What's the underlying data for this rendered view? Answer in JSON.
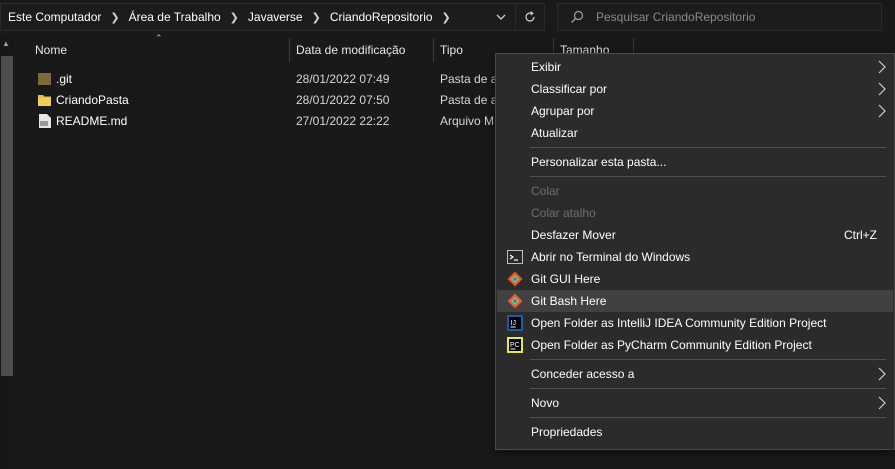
{
  "address": {
    "crumbs": [
      "Este Computador",
      "Área de Trabalho",
      "Javaverse",
      "CriandoRepositorio"
    ]
  },
  "search": {
    "placeholder": "Pesquisar CriandoRepositorio"
  },
  "columns": {
    "name": "Nome",
    "date": "Data de modificação",
    "type": "Tipo",
    "size": "Tamanho"
  },
  "files": [
    {
      "name": ".git",
      "date": "28/01/2022 07:49",
      "type": "Pasta de arquivos",
      "icon": "folder-hidden-icon"
    },
    {
      "name": "CriandoPasta",
      "date": "28/01/2022 07:50",
      "type": "Pasta de arquivos",
      "icon": "folder-icon"
    },
    {
      "name": "README.md",
      "date": "27/01/2022 22:22",
      "type": "Arquivo MD",
      "icon": "md-file-icon"
    }
  ],
  "menu": {
    "view": "Exibir",
    "sort": "Classificar por",
    "group": "Agrupar por",
    "refresh": "Atualizar",
    "customize": "Personalizar esta pasta...",
    "paste": "Colar",
    "paste_shortcut": "Colar atalho",
    "undo": "Desfazer Mover",
    "undo_shortcut": "Ctrl+Z",
    "terminal": "Abrir no Terminal do Windows",
    "git_gui": "Git GUI Here",
    "git_bash": "Git Bash Here",
    "intellij": "Open Folder as IntelliJ IDEA Community Edition Project",
    "pycharm": "Open Folder as PyCharm Community Edition Project",
    "share": "Conceder acesso a",
    "new": "Novo",
    "properties": "Propriedades"
  },
  "colors": {
    "background": "#191919",
    "menu": "#2b2b2b",
    "highlight": "#414141",
    "git": "#f05033"
  }
}
